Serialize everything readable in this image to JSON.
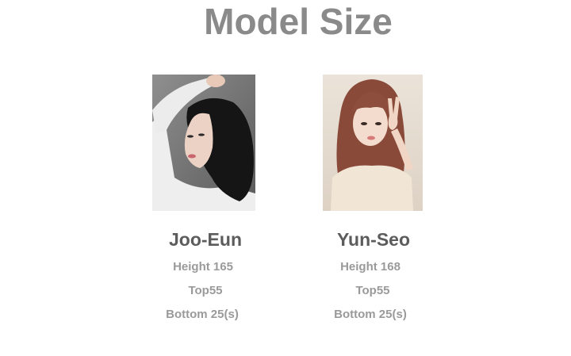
{
  "page": {
    "title": "Model Size"
  },
  "models": [
    {
      "name": "Joo-Eun",
      "height": "Height 165",
      "top": "Top55",
      "bottom": "Bottom 25(s)"
    },
    {
      "name": "Yun-Seo",
      "height": "Height 168",
      "top": "Top55",
      "bottom": "Bottom 25(s)"
    }
  ],
  "colors": {
    "title": "#8a8a8a",
    "name": "#5c5c5c",
    "stat": "#9a9a9a",
    "background": "#ffffff"
  }
}
